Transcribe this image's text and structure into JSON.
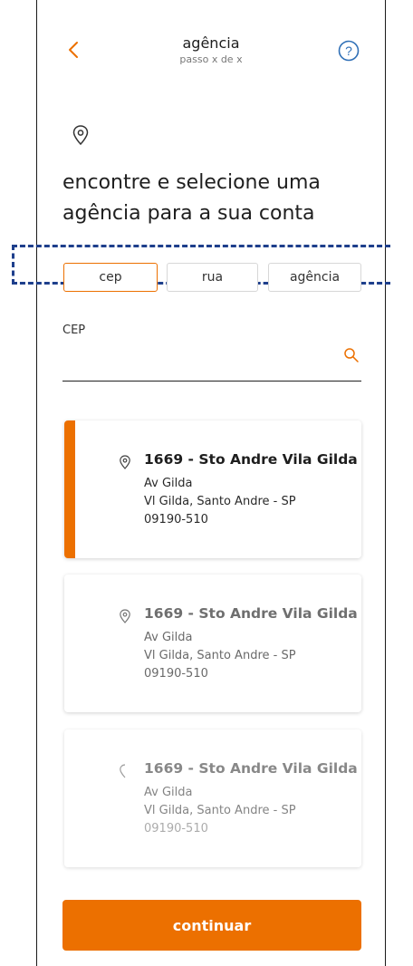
{
  "header": {
    "title": "agência",
    "subtitle": "passo x de x"
  },
  "headline": "encontre e selecione uma agência para a sua conta",
  "tabs": [
    {
      "label": "cep",
      "active": true
    },
    {
      "label": "rua",
      "active": false
    },
    {
      "label": "agência",
      "active": false
    }
  ],
  "search": {
    "label": "CEP",
    "value": ""
  },
  "agencies": [
    {
      "name": "1669 - Sto Andre Vila Gilda",
      "street": "Av Gilda",
      "district": "Vl Gilda, Santo Andre - SP",
      "cep": "09190-510",
      "selected": true
    },
    {
      "name": "1669 - Sto Andre Vila Gilda",
      "street": "Av Gilda",
      "district": "Vl Gilda, Santo Andre - SP",
      "cep": "09190-510",
      "selected": false
    },
    {
      "name": "1669 - Sto Andre Vila Gilda",
      "street": "Av Gilda",
      "district": "Vl Gilda, Santo Andre - SP",
      "cep": "09190-510",
      "selected": false
    }
  ],
  "continue_label": "continuar",
  "colors": {
    "accent": "#ec7000",
    "highlight_dash": "#1e3f8c",
    "help_icon": "#2f6fb6"
  },
  "icons": [
    "back-chevron-icon",
    "help-icon",
    "location-pin-icon",
    "search-icon"
  ]
}
